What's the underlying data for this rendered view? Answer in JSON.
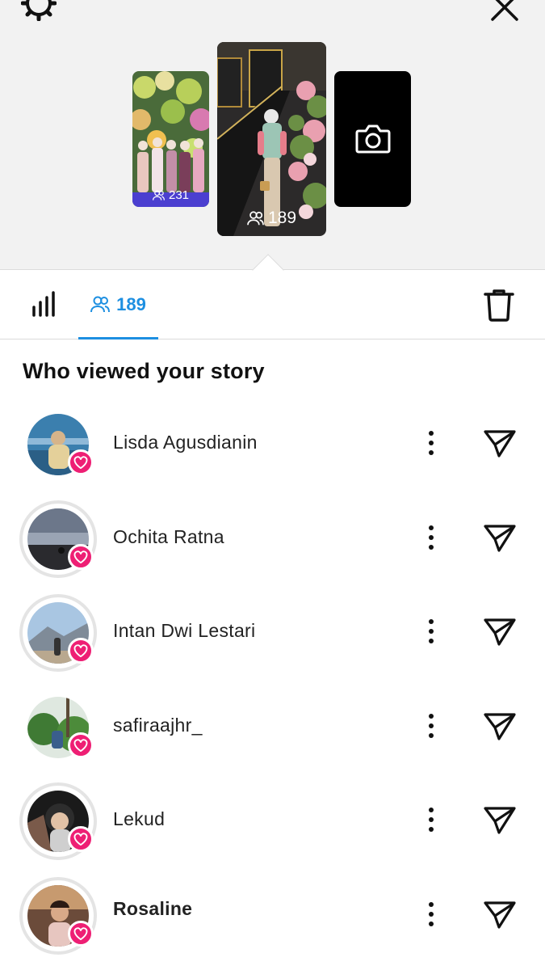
{
  "stories": [
    {
      "views": "231",
      "type": "photo-group"
    },
    {
      "views": "189",
      "type": "photo-stairs",
      "selected": true
    },
    {
      "type": "camera",
      "icon": "camera-icon"
    }
  ],
  "tabs": {
    "insights_icon": "bar-chart-icon",
    "viewers_icon": "people-icon",
    "viewers_count": "189",
    "delete_icon": "trash-icon"
  },
  "section_title": "Who viewed your story",
  "viewers": [
    {
      "name": "Lisda Agusdianin",
      "liked": true,
      "ring": false
    },
    {
      "name": "Ochita Ratna",
      "liked": true,
      "ring": true
    },
    {
      "name": "Intan Dwi Lestari",
      "liked": true,
      "ring": true
    },
    {
      "name": "safiraajhr_",
      "liked": true,
      "ring": false
    },
    {
      "name": "Lekud",
      "liked": true,
      "ring": true
    },
    {
      "name": "Rosaline",
      "liked": true,
      "ring": true
    }
  ],
  "colors": {
    "accent": "#1d8fe1",
    "heart": "#ee1f74",
    "top_bg": "#f2f2f2"
  }
}
